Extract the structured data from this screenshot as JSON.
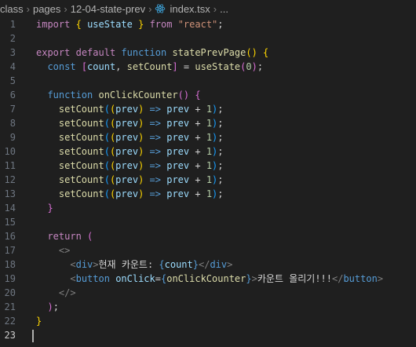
{
  "breadcrumb": [
    "class",
    "pages",
    "12-04-state-prev",
    "index.tsx",
    "..."
  ],
  "lines": [
    [
      [
        "import",
        "kw"
      ],
      [
        " ",
        ""
      ],
      [
        "{",
        "br1"
      ],
      [
        " ",
        ""
      ],
      [
        "useState",
        "var"
      ],
      [
        " ",
        ""
      ],
      [
        "}",
        "br1"
      ],
      [
        " ",
        ""
      ],
      [
        "from",
        "kw"
      ],
      [
        " ",
        ""
      ],
      [
        "\"react\"",
        "str"
      ],
      [
        ";",
        "op"
      ]
    ],
    [],
    [
      [
        "export",
        "kw"
      ],
      [
        " ",
        ""
      ],
      [
        "default",
        "kw"
      ],
      [
        " ",
        ""
      ],
      [
        "function",
        "kwb"
      ],
      [
        " ",
        ""
      ],
      [
        "statePrevPage",
        "fn"
      ],
      [
        "()",
        "br1"
      ],
      [
        " ",
        ""
      ],
      [
        "{",
        "br1"
      ]
    ],
    [
      [
        "  ",
        ""
      ],
      [
        "const",
        "kwb"
      ],
      [
        " ",
        ""
      ],
      [
        "[",
        "br2"
      ],
      [
        "count",
        "var"
      ],
      [
        ", ",
        "op"
      ],
      [
        "setCount",
        "fn"
      ],
      [
        "]",
        "br2"
      ],
      [
        " = ",
        "op"
      ],
      [
        "useState",
        "fn"
      ],
      [
        "(",
        "br2"
      ],
      [
        "0",
        "num"
      ],
      [
        ")",
        "br2"
      ],
      [
        ";",
        "op"
      ]
    ],
    [],
    [
      [
        "  ",
        ""
      ],
      [
        "function",
        "kwb"
      ],
      [
        " ",
        ""
      ],
      [
        "onClickCounter",
        "fn"
      ],
      [
        "()",
        "br2"
      ],
      [
        " ",
        ""
      ],
      [
        "{",
        "br2"
      ]
    ],
    [
      [
        "    ",
        ""
      ],
      [
        "setCount",
        "fn"
      ],
      [
        "(",
        "br3"
      ],
      [
        "(",
        "br1"
      ],
      [
        "prev",
        "var"
      ],
      [
        ")",
        "br1"
      ],
      [
        " => ",
        "kwb"
      ],
      [
        "prev",
        "var"
      ],
      [
        " + ",
        "op"
      ],
      [
        "1",
        "num"
      ],
      [
        ")",
        "br3"
      ],
      [
        ";",
        "op"
      ]
    ],
    [
      [
        "    ",
        ""
      ],
      [
        "setCount",
        "fn"
      ],
      [
        "(",
        "br3"
      ],
      [
        "(",
        "br1"
      ],
      [
        "prev",
        "var"
      ],
      [
        ")",
        "br1"
      ],
      [
        " => ",
        "kwb"
      ],
      [
        "prev",
        "var"
      ],
      [
        " + ",
        "op"
      ],
      [
        "1",
        "num"
      ],
      [
        ")",
        "br3"
      ],
      [
        ";",
        "op"
      ]
    ],
    [
      [
        "    ",
        ""
      ],
      [
        "setCount",
        "fn"
      ],
      [
        "(",
        "br3"
      ],
      [
        "(",
        "br1"
      ],
      [
        "prev",
        "var"
      ],
      [
        ")",
        "br1"
      ],
      [
        " => ",
        "kwb"
      ],
      [
        "prev",
        "var"
      ],
      [
        " + ",
        "op"
      ],
      [
        "1",
        "num"
      ],
      [
        ")",
        "br3"
      ],
      [
        ";",
        "op"
      ]
    ],
    [
      [
        "    ",
        ""
      ],
      [
        "setCount",
        "fn"
      ],
      [
        "(",
        "br3"
      ],
      [
        "(",
        "br1"
      ],
      [
        "prev",
        "var"
      ],
      [
        ")",
        "br1"
      ],
      [
        " => ",
        "kwb"
      ],
      [
        "prev",
        "var"
      ],
      [
        " + ",
        "op"
      ],
      [
        "1",
        "num"
      ],
      [
        ")",
        "br3"
      ],
      [
        ";",
        "op"
      ]
    ],
    [
      [
        "    ",
        ""
      ],
      [
        "setCount",
        "fn"
      ],
      [
        "(",
        "br3"
      ],
      [
        "(",
        "br1"
      ],
      [
        "prev",
        "var"
      ],
      [
        ")",
        "br1"
      ],
      [
        " => ",
        "kwb"
      ],
      [
        "prev",
        "var"
      ],
      [
        " + ",
        "op"
      ],
      [
        "1",
        "num"
      ],
      [
        ")",
        "br3"
      ],
      [
        ";",
        "op"
      ]
    ],
    [
      [
        "    ",
        ""
      ],
      [
        "setCount",
        "fn"
      ],
      [
        "(",
        "br3"
      ],
      [
        "(",
        "br1"
      ],
      [
        "prev",
        "var"
      ],
      [
        ")",
        "br1"
      ],
      [
        " => ",
        "kwb"
      ],
      [
        "prev",
        "var"
      ],
      [
        " + ",
        "op"
      ],
      [
        "1",
        "num"
      ],
      [
        ")",
        "br3"
      ],
      [
        ";",
        "op"
      ]
    ],
    [
      [
        "    ",
        ""
      ],
      [
        "setCount",
        "fn"
      ],
      [
        "(",
        "br3"
      ],
      [
        "(",
        "br1"
      ],
      [
        "prev",
        "var"
      ],
      [
        ")",
        "br1"
      ],
      [
        " => ",
        "kwb"
      ],
      [
        "prev",
        "var"
      ],
      [
        " + ",
        "op"
      ],
      [
        "1",
        "num"
      ],
      [
        ")",
        "br3"
      ],
      [
        ";",
        "op"
      ]
    ],
    [
      [
        "  ",
        ""
      ],
      [
        "}",
        "br2"
      ]
    ],
    [],
    [
      [
        "  ",
        ""
      ],
      [
        "return",
        "kw"
      ],
      [
        " ",
        ""
      ],
      [
        "(",
        "br2"
      ]
    ],
    [
      [
        "    ",
        ""
      ],
      [
        "<>",
        "tag"
      ]
    ],
    [
      [
        "      ",
        ""
      ],
      [
        "<",
        "tag"
      ],
      [
        "div",
        "tagn"
      ],
      [
        ">",
        "tag"
      ],
      [
        "현재 카운트: ",
        "txt"
      ],
      [
        "{",
        "kwb"
      ],
      [
        "count",
        "var"
      ],
      [
        "}",
        "kwb"
      ],
      [
        "</",
        "tag"
      ],
      [
        "div",
        "tagn"
      ],
      [
        ">",
        "tag"
      ]
    ],
    [
      [
        "      ",
        ""
      ],
      [
        "<",
        "tag"
      ],
      [
        "button",
        "tagn"
      ],
      [
        " ",
        ""
      ],
      [
        "onClick",
        "attr"
      ],
      [
        "=",
        "op"
      ],
      [
        "{",
        "kwb"
      ],
      [
        "onClickCounter",
        "fn"
      ],
      [
        "}",
        "kwb"
      ],
      [
        ">",
        "tag"
      ],
      [
        "카운트 올리기!!!",
        "txt"
      ],
      [
        "</",
        "tag"
      ],
      [
        "button",
        "tagn"
      ],
      [
        ">",
        "tag"
      ]
    ],
    [
      [
        "    ",
        ""
      ],
      [
        "</>",
        "tag"
      ]
    ],
    [
      [
        "  ",
        ""
      ],
      [
        ")",
        "br2"
      ],
      [
        ";",
        "op"
      ]
    ],
    [
      [
        "}",
        "br1"
      ]
    ],
    []
  ],
  "active_line": 23,
  "colors": {
    "background": "#1f1f1f",
    "react_icon": "#3ea6de"
  }
}
